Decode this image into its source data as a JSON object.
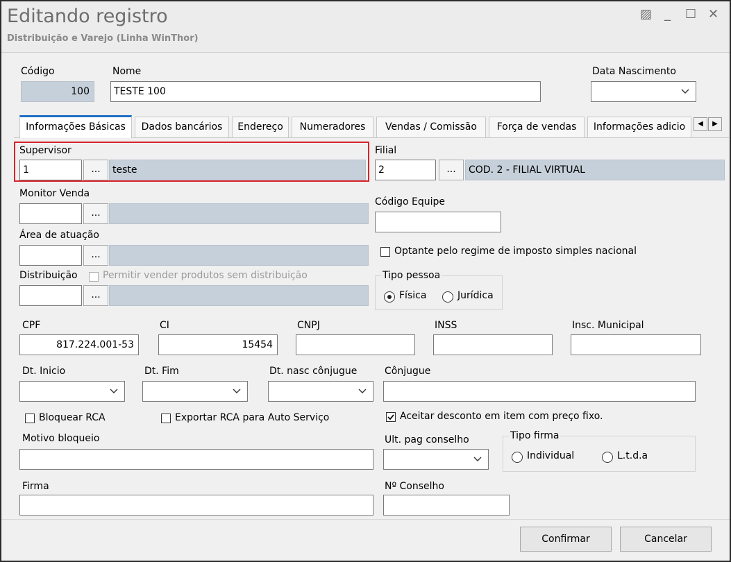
{
  "window": {
    "title": "Editando registro",
    "subtitle": "Distribuição e Varejo (Linha WinThor)",
    "controls": [
      "▨",
      "_",
      "☐",
      "✕"
    ]
  },
  "header": {
    "codigo_label": "Código",
    "codigo_value": "100",
    "nome_label": "Nome",
    "nome_value": "TESTE 100",
    "data_nascimento_label": "Data Nascimento",
    "data_nascimento_value": ""
  },
  "tabs": [
    {
      "label": "Informações Básicas",
      "active": true
    },
    {
      "label": "Dados bancários"
    },
    {
      "label": "Endereço"
    },
    {
      "label": "Numeradores"
    },
    {
      "label": "Vendas  / Comissão"
    },
    {
      "label": "Força de vendas"
    },
    {
      "label": "Informações adicio"
    }
  ],
  "tab_scroll": {
    "left": "◀",
    "right": "▶"
  },
  "basic": {
    "supervisor_label": "Supervisor",
    "supervisor_code": "1",
    "supervisor_name": "teste",
    "filial_label": "Filial",
    "filial_code": "2",
    "filial_name": "COD. 2 - FILIAL VIRTUAL",
    "monitor_label": "Monitor Venda",
    "monitor_code": "",
    "monitor_name": "",
    "codigo_equipe_label": "Código Equipe",
    "codigo_equipe_value": "",
    "area_label": "Área de atuação",
    "area_code": "",
    "area_name": "",
    "optante_label": "Optante pelo regime de imposto simples nacional",
    "distribuicao_label": "Distribuição",
    "permitir_label": "Permitir vender produtos sem distribuição",
    "distribuicao_code": "",
    "distribuicao_name": "",
    "tipo_pessoa_title": "Tipo pessoa",
    "tipo_pessoa_fisica": "Física",
    "tipo_pessoa_juridica": "Jurídica",
    "ellipsis": "..."
  },
  "docs": {
    "cpf_label": "CPF",
    "cpf_value": "817.224.001-53",
    "ci_label": "CI",
    "ci_value": "15454",
    "cnpj_label": "CNPJ",
    "cnpj_value": "",
    "inss_label": "INSS",
    "inss_value": "",
    "insc_label": "Insc. Municipal",
    "insc_value": ""
  },
  "dates": {
    "dt_inicio_label": "Dt. Inicio",
    "dt_fim_label": "Dt. Fim",
    "dt_nasc_conj_label": "Dt. nasc cônjugue",
    "conjugue_label": "Cônjugue",
    "conjugue_value": ""
  },
  "flags": {
    "bloquear_label": "Bloquear RCA",
    "exportar_label": "Exportar RCA para Auto Serviço",
    "aceitar_label": "Aceitar desconto em item com preço fixo."
  },
  "bottom": {
    "motivo_label": "Motivo bloqueio",
    "ult_pag_label": "Ult. pag conselho",
    "tipo_firma_title": "Tipo firma",
    "tipo_firma_individual": "Individual",
    "tipo_firma_ltda": "L.t.d.a",
    "firma_label": "Firma",
    "conselho_label": "Nº Conselho"
  },
  "footer": {
    "confirmar_label": "Confirmar",
    "cancelar_label": "Cancelar"
  },
  "colors": {
    "highlight": "#d8242b",
    "readonly_fill": "#c6d0da",
    "active_tab_accent": "#1e6fc4"
  }
}
